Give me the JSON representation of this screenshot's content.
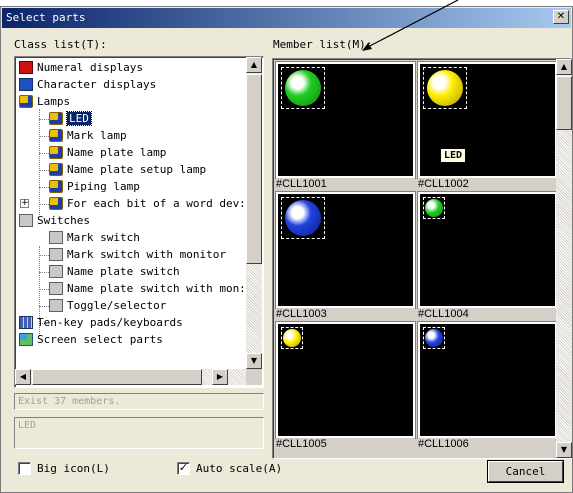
{
  "window": {
    "title": "Select parts",
    "close_glyph": "✕"
  },
  "class_list": {
    "label": "Class list(T):",
    "items": [
      {
        "label": "Numeral displays",
        "icon": "numeral-display-icon"
      },
      {
        "label": "Character displays",
        "icon": "character-display-icon"
      },
      {
        "label": "Lamps",
        "icon": "lamp-icon"
      },
      {
        "label": "LED",
        "icon": "lamp-icon",
        "selected": true
      },
      {
        "label": "Mark lamp",
        "icon": "lamp-icon"
      },
      {
        "label": "Name plate lamp",
        "icon": "lamp-icon"
      },
      {
        "label": "Name plate setup lamp",
        "icon": "lamp-icon"
      },
      {
        "label": "Piping lamp",
        "icon": "lamp-icon"
      },
      {
        "label": "For each bit of a word dev:",
        "icon": "lamp-icon"
      },
      {
        "label": "Switches",
        "icon": "switch-icon"
      },
      {
        "label": "Mark switch",
        "icon": "switch-icon"
      },
      {
        "label": "Mark switch with monitor",
        "icon": "switch-icon"
      },
      {
        "label": "Name plate switch",
        "icon": "switch-icon"
      },
      {
        "label": "Name plate switch with mon:",
        "icon": "switch-icon"
      },
      {
        "label": "Toggle/selector",
        "icon": "switch-icon"
      },
      {
        "label": "Ten-key pads/keyboards",
        "icon": "ten-key-icon"
      },
      {
        "label": "Screen select parts",
        "icon": "screen-select-icon"
      }
    ],
    "expander_glyph": "+"
  },
  "member_count_text": "Exist 37 members.",
  "selected_class_text": "LED",
  "member_list": {
    "label": "Member list(M):",
    "members": [
      {
        "name": "#CLL1001",
        "color": "#22cc22",
        "tag": ""
      },
      {
        "name": "#CLL1002",
        "color": "#ffee00",
        "tag": "LED"
      },
      {
        "name": "#CLL1003",
        "color": "#1a33cc",
        "tag": ""
      },
      {
        "name": "#CLL1004",
        "color": "#22cc22",
        "tag": ""
      },
      {
        "name": "#CLL1005",
        "color": "#ffee00",
        "tag": ""
      },
      {
        "name": "#CLL1006",
        "color": "#1a33cc",
        "tag": ""
      }
    ]
  },
  "options": {
    "big_icon_label": "Big icon(L)",
    "big_icon_checked": false,
    "auto_scale_label": "Auto scale(A)",
    "auto_scale_checked": true,
    "check_glyph": "✓"
  },
  "buttons": {
    "cancel_label": "Cancel"
  },
  "scroll_glyphs": {
    "up": "▲",
    "down": "▼",
    "left": "◀",
    "right": "▶"
  }
}
